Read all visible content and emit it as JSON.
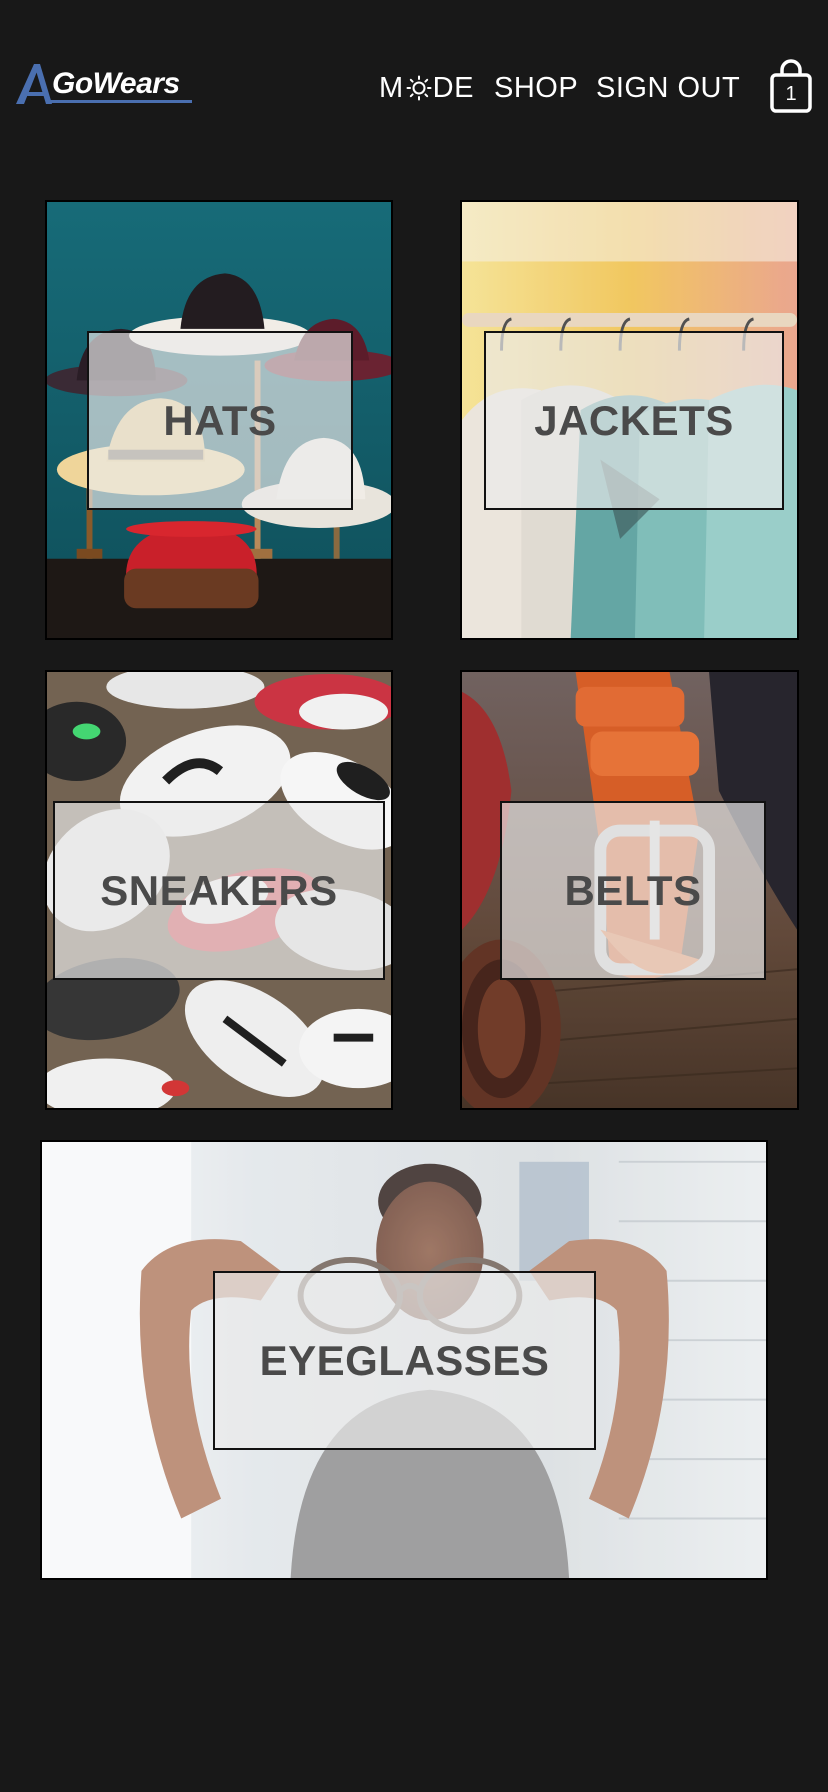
{
  "brand": {
    "name": "GoWears",
    "accent": "#4a6fb0"
  },
  "nav": {
    "mode_label_before": "M",
    "mode_label_after": "DE",
    "mode_icon": "sun-icon",
    "shop_label": "SHOP",
    "signout_label": "SIGN OUT"
  },
  "cart": {
    "icon": "shopping-bag-icon",
    "count": "1"
  },
  "categories": [
    {
      "label": "HATS",
      "image": "hats-photo"
    },
    {
      "label": "JACKETS",
      "image": "jackets-photo"
    },
    {
      "label": "SNEAKERS",
      "image": "sneakers-photo"
    },
    {
      "label": "BELTS",
      "image": "belts-photo"
    },
    {
      "label": "EYEGLASSES",
      "image": "eyeglasses-photo"
    }
  ],
  "colors": {
    "background": "#181818",
    "label_box": "rgba(235,235,235,0.68)",
    "label_text": "#4a4a4a"
  }
}
